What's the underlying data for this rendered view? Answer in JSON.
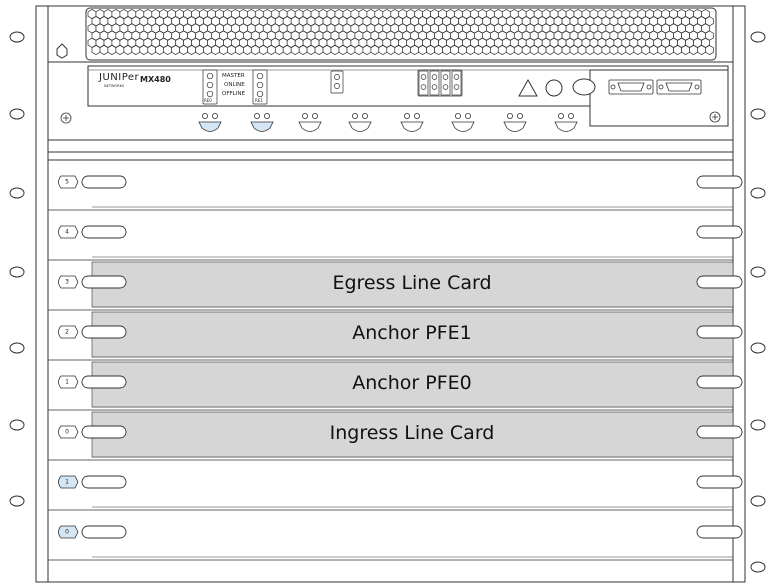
{
  "chassis": {
    "brand_logo": "JUNIPer",
    "brand_sub": "NETWORKS",
    "model": "MX480"
  },
  "re_panel": {
    "re0_label": "RE0",
    "re1_label": "RE1",
    "status_labels": [
      "MASTER",
      "ONLINE",
      "OFFLINE"
    ]
  },
  "slots": [
    {
      "number": "5",
      "card": "",
      "highlighted": false,
      "label_style": "default"
    },
    {
      "number": "4",
      "card": "",
      "highlighted": false,
      "label_style": "default"
    },
    {
      "number": "3",
      "card": "Egress Line Card",
      "highlighted": true,
      "label_style": "default"
    },
    {
      "number": "2",
      "card": "Anchor PFE1",
      "highlighted": true,
      "label_style": "default"
    },
    {
      "number": "1",
      "card": "Anchor PFE0",
      "highlighted": true,
      "label_style": "default"
    },
    {
      "number": "0",
      "card": "Ingress Line Card",
      "highlighted": true,
      "label_style": "default"
    },
    {
      "number": "1",
      "card": "",
      "highlighted": false,
      "label_style": "blue"
    },
    {
      "number": "0",
      "card": "",
      "highlighted": false,
      "label_style": "blue"
    }
  ],
  "colors": {
    "card_fill": "#d6d6d6",
    "blue_fill": "#d4e6f4",
    "line": "#333333"
  }
}
